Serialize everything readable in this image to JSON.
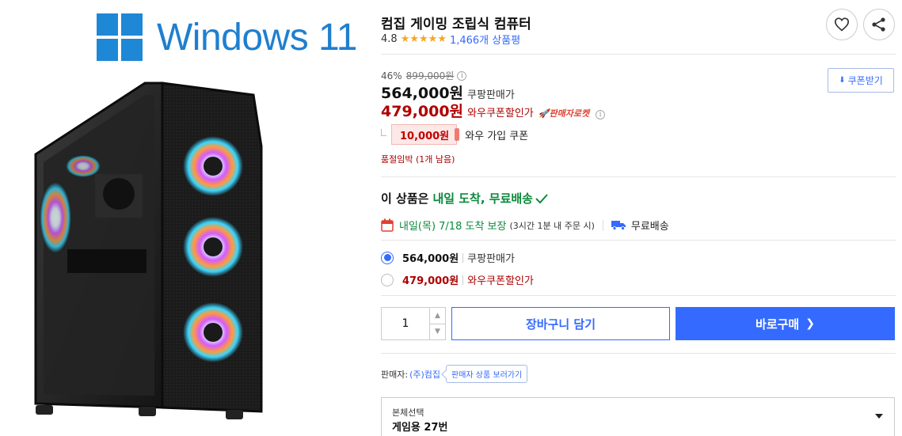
{
  "product": {
    "title": "컴집 게이밍 조립식 컴퓨터",
    "rating": "4.8",
    "stars": 5,
    "review_count": "1,466개 상품평",
    "image": {
      "logo_text": "Windows 11",
      "description_icon": "pc-case-image"
    }
  },
  "price": {
    "discount_rate": "46%",
    "original": "899,000원",
    "main": "564,000원",
    "main_label": "쿠팡판매가",
    "wow": "479,000원",
    "wow_label": "와우쿠폰할인가",
    "rocket_badge": "판매자로켓",
    "coupon_button": "쿠폰받기",
    "wow_coupon_amount": "10,000원",
    "wow_coupon_text": "와우 가입 쿠폰",
    "stock": "품절임박 (1개 남음)"
  },
  "delivery": {
    "headline_prefix": "이 상품은",
    "headline_highlight": "내일 도착, 무료배송",
    "arrival": "내일(목) 7/18 도착 보장",
    "arrival_sub": "(3시간 1분 내 주문 시)",
    "free_shipping": "무료배송"
  },
  "options": [
    {
      "price": "564,000원",
      "label": "쿠팡판매가",
      "selected": true
    },
    {
      "price": "479,000원",
      "label": "와우쿠폰할인가",
      "selected": false
    }
  ],
  "purchase": {
    "quantity": "1",
    "cart_button": "장바구니 담기",
    "buy_button": "바로구매"
  },
  "seller": {
    "label": "판매자:",
    "name": "(주)컴집",
    "tooltip": "판매자 상품 보러가기"
  },
  "select": {
    "label": "본체선택",
    "value": "게임용 27번"
  },
  "colors": {
    "accent": "#346aff",
    "wow_red": "#ae0000",
    "delivery_green": "#0b8a3b",
    "star": "#f5a623",
    "windows_blue": "#1e88d6"
  }
}
